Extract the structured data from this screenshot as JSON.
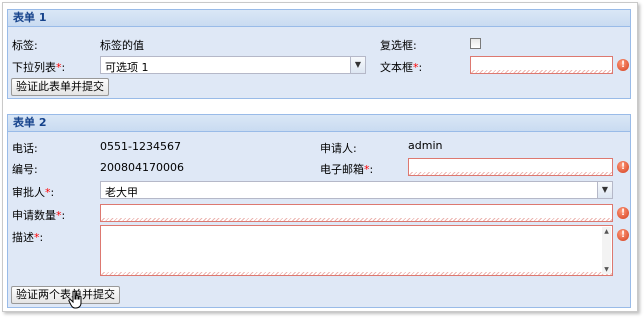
{
  "form1": {
    "title": "表单 1",
    "label_field_label": "标签:",
    "label_field_value": "标签的值",
    "checkbox_label": "复选框:",
    "dropdown_label": "下拉列表",
    "dropdown_value": "可选项 1",
    "textfield_label": "文本框",
    "submit_label": "验证此表单并提交"
  },
  "form2": {
    "title": "表单 2",
    "phone_label": "电话:",
    "phone_value": "0551-1234567",
    "applicant_label": "申请人:",
    "applicant_value": "admin",
    "number_label": "编号:",
    "number_value": "200804170006",
    "email_label": "电子邮箱",
    "approver_label": "审批人",
    "approver_value": "老大甲",
    "quantity_label": "申请数量",
    "description_label": "描述",
    "submit_label": "验证两个表单并提交"
  },
  "common": {
    "required_mark": "*",
    "colon": ":",
    "error_glyph": "!"
  }
}
